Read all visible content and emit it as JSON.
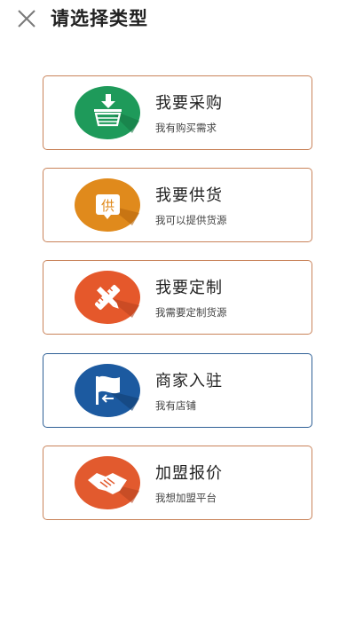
{
  "header": {
    "title": "请选择类型",
    "close_icon": "close-icon"
  },
  "options": [
    {
      "label": "我要采购",
      "desc": "我有购买需求",
      "icon": "basket-icon",
      "color": "#1e9a5a"
    },
    {
      "label": "我要供货",
      "desc": "我可以提供货源",
      "icon": "supply-icon",
      "icon_text": "供",
      "color": "#e08a1c"
    },
    {
      "label": "我要定制",
      "desc": "我需要定制货源",
      "icon": "tools-icon",
      "color": "#e5582b"
    },
    {
      "label": "商家入驻",
      "desc": "我有店铺",
      "icon": "flag-icon",
      "color": "#1c5aa0"
    },
    {
      "label": "加盟报价",
      "desc": "我想加盟平台",
      "icon": "handshake-icon",
      "color": "#e25a2e"
    }
  ]
}
